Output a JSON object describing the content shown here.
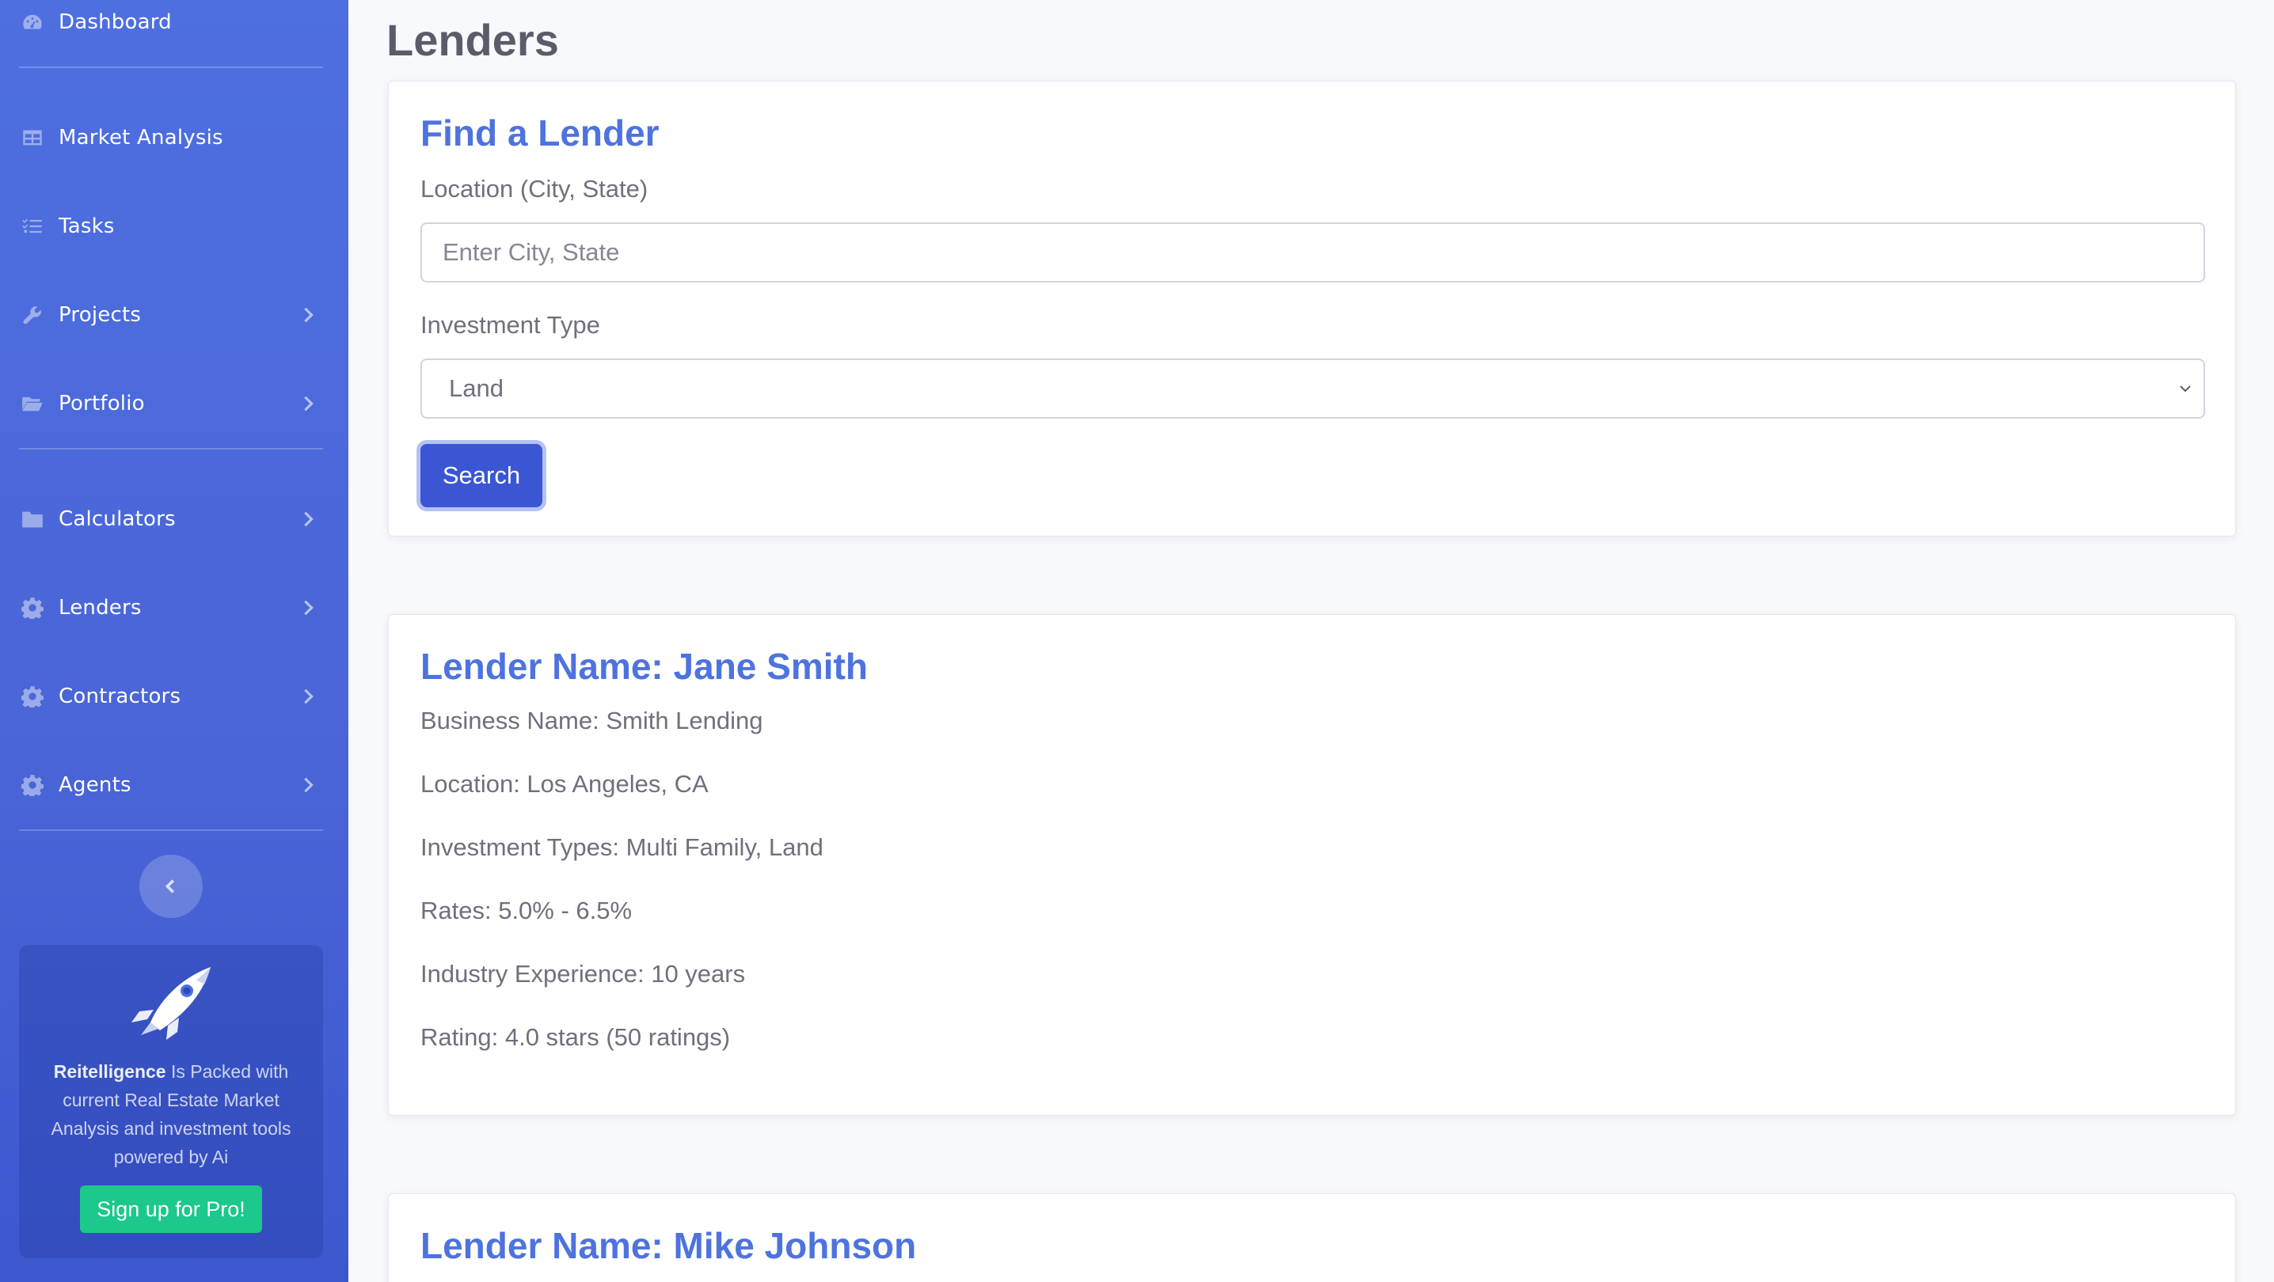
{
  "sidebar": {
    "items": [
      {
        "label": "Dashboard",
        "icon": "dashboard-icon",
        "has_chevron": false
      },
      {
        "label": "Market Analysis",
        "icon": "table-icon",
        "has_chevron": false
      },
      {
        "label": "Tasks",
        "icon": "tasks-icon",
        "has_chevron": false
      },
      {
        "label": "Projects",
        "icon": "wrench-icon",
        "has_chevron": true
      },
      {
        "label": "Portfolio",
        "icon": "folder-open-icon",
        "has_chevron": true
      },
      {
        "label": "Calculators",
        "icon": "folder-icon",
        "has_chevron": true
      },
      {
        "label": "Lenders",
        "icon": "cog-icon",
        "has_chevron": true
      },
      {
        "label": "Contractors",
        "icon": "cog-icon",
        "has_chevron": true
      },
      {
        "label": "Agents",
        "icon": "cog-icon",
        "has_chevron": true
      }
    ],
    "promo": {
      "brand": "Reitelligence",
      "text": "Is Packed with current Real Estate Market Analysis and investment tools powered by Ai",
      "button_label": "Sign up for Pro!"
    }
  },
  "page": {
    "title": "Lenders"
  },
  "search_card": {
    "heading": "Find a Lender",
    "location_label": "Location (City, State)",
    "location_placeholder": "Enter City, State",
    "location_value": "",
    "type_label": "Investment Type",
    "type_selected": "Land",
    "search_label": "Search"
  },
  "lenders": [
    {
      "name": "Lender Name: Jane Smith",
      "business": "Business Name: Smith Lending",
      "location": "Location: Los Angeles, CA",
      "types": "Investment Types: Multi Family, Land",
      "rates": "Rates: 5.0% - 6.5%",
      "experience": "Industry Experience: 10 years",
      "rating": "Rating: 4.0 stars (50 ratings)"
    },
    {
      "name": "Lender Name: Mike Johnson"
    }
  ],
  "colors": {
    "sidebar_bg": "#4e6fe0",
    "accent": "#4e73df",
    "button_primary": "#3a56d4",
    "button_success": "#1cc88a",
    "text_muted": "#6e707e"
  }
}
